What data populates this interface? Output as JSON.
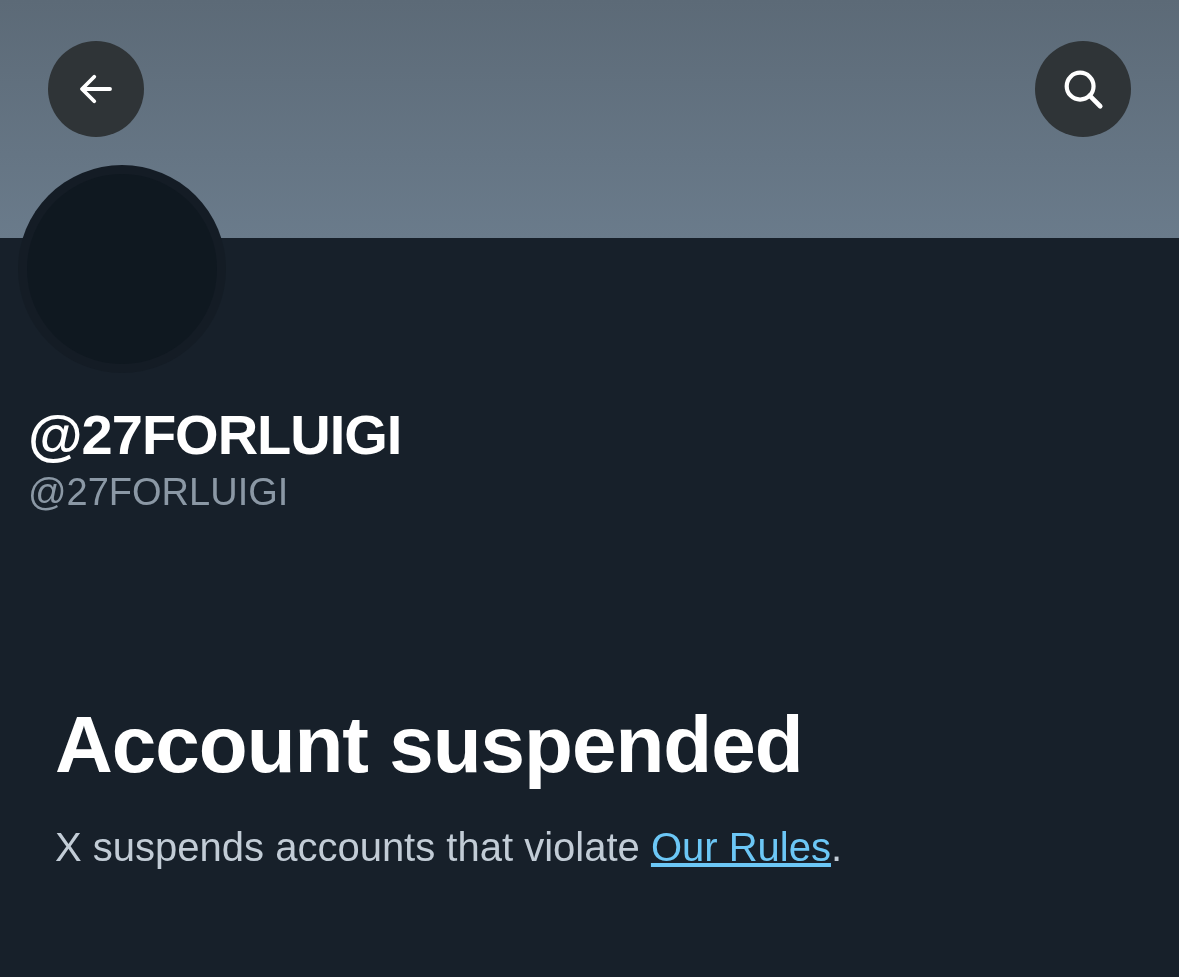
{
  "profile": {
    "display_name": "@27FORLUIGI",
    "handle": "@27FORLUIGI"
  },
  "notice": {
    "title": "Account suspended",
    "text_before": "X suspends accounts that violate ",
    "link": "Our Rules",
    "text_after": "."
  }
}
